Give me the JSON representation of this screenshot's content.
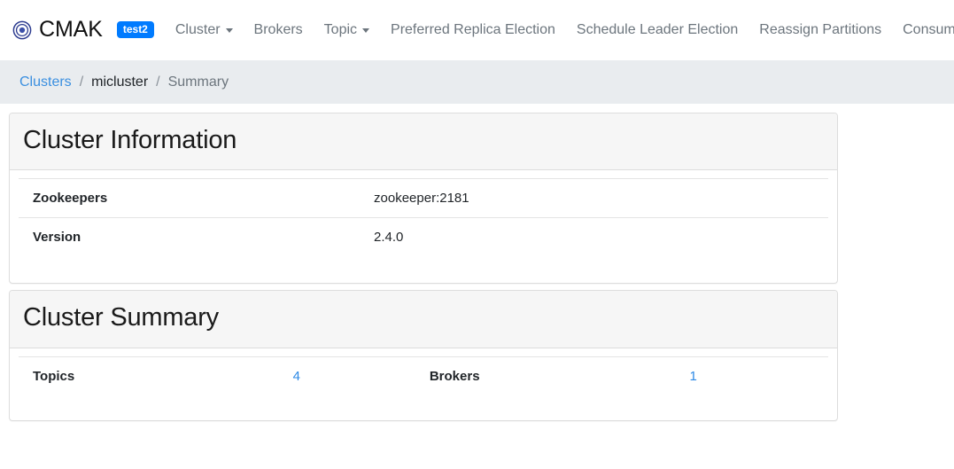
{
  "navbar": {
    "brand": {
      "icon": "target-circle-icon",
      "label": "CMAK"
    },
    "cluster_badge": "test2",
    "items": [
      {
        "label": "Cluster",
        "has_caret": true
      },
      {
        "label": "Brokers",
        "has_caret": false
      },
      {
        "label": "Topic",
        "has_caret": true
      },
      {
        "label": "Preferred Replica Election",
        "has_caret": false
      },
      {
        "label": "Schedule Leader Election",
        "has_caret": false
      },
      {
        "label": "Reassign Partitions",
        "has_caret": false
      },
      {
        "label": "Consumers",
        "has_caret": false
      }
    ]
  },
  "breadcrumb": {
    "separator": "/",
    "items": [
      {
        "label": "Clusters",
        "type": "link"
      },
      {
        "label": "micluster",
        "type": "dark"
      },
      {
        "label": "Summary",
        "type": "active"
      }
    ]
  },
  "panels": {
    "cluster_information": {
      "title": "Cluster Information",
      "rows": [
        {
          "label": "Zookeepers",
          "value": "zookeeper:2181"
        },
        {
          "label": "Version",
          "value": "2.4.0"
        }
      ]
    },
    "cluster_summary": {
      "title": "Cluster Summary",
      "rows": [
        {
          "label1": "Topics",
          "value1": "4",
          "label2": "Brokers",
          "value2": "1"
        }
      ]
    }
  },
  "colors": {
    "brand_blue": "#007bff",
    "link_blue": "#2e8ae6",
    "breadcrumb_bg": "#e9ecef",
    "panel_heading_bg": "#f6f6f6",
    "muted_text": "#6c757d"
  }
}
